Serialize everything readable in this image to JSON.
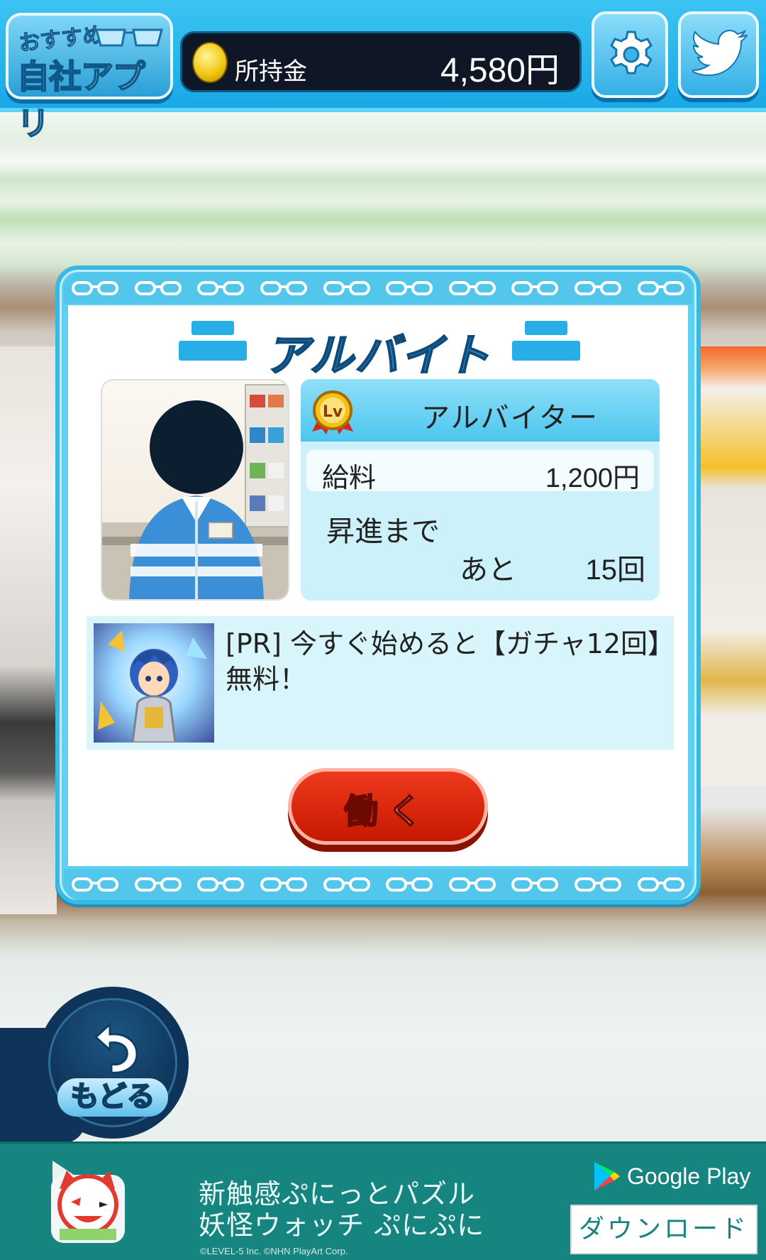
{
  "header": {
    "apps_button": {
      "line1": "おすすめ",
      "line2": "自社アプリ"
    },
    "money": {
      "label": "所持金",
      "value": "4,580円"
    }
  },
  "modal": {
    "title": "アルバイト",
    "job": {
      "level_badge": "Lv",
      "name": "アルバイター",
      "salary_label": "給料",
      "salary_value": "1,200円",
      "promotion_label": "昇進まで",
      "promotion_remaining_label": "あと",
      "promotion_remaining_value": "15回"
    },
    "ad": {
      "text": "[PR] 今すぐ始めると【ガチャ12回】無料！"
    },
    "work_button": "働く"
  },
  "back_button": {
    "label": "もどる"
  },
  "banner": {
    "line1": "新触感ぷにっとパズル",
    "line2": "妖怪ウォッチ ぷにぷに",
    "copyright": "©LEVEL-5 Inc. ©NHN PlayArt Corp.",
    "store": "Google Play",
    "download": "ダウンロード"
  },
  "colors": {
    "header_blue": "#1aa9e6",
    "modal_border": "#5fd0f0",
    "work_button_red": "#d82a10",
    "banner_teal": "#16857f"
  }
}
